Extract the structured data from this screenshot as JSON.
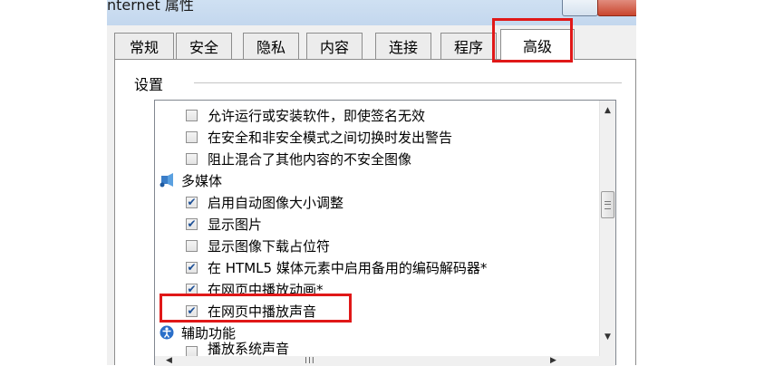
{
  "window": {
    "title": "nternet 属性"
  },
  "tabs": [
    {
      "label": "常规",
      "active": false
    },
    {
      "label": "安全",
      "active": false
    },
    {
      "label": "隐私",
      "active": false
    },
    {
      "label": "内容",
      "active": false
    },
    {
      "label": "连接",
      "active": false
    },
    {
      "label": "程序",
      "active": false
    },
    {
      "label": "高级",
      "active": true
    }
  ],
  "settings": {
    "label": "设置",
    "items": [
      {
        "type": "option",
        "label": "允许运行或安装软件，即使签名无效",
        "checked": false
      },
      {
        "type": "option",
        "label": "在安全和非安全模式之间切换时发出警告",
        "checked": false
      },
      {
        "type": "option",
        "label": "阻止混合了其他内容的不安全图像",
        "checked": false
      },
      {
        "type": "category",
        "label": "多媒体",
        "icon": "multimedia-icon"
      },
      {
        "type": "option",
        "label": "启用自动图像大小调整",
        "checked": true
      },
      {
        "type": "option",
        "label": "显示图片",
        "checked": true
      },
      {
        "type": "option",
        "label": "显示图像下载占位符",
        "checked": false
      },
      {
        "type": "option",
        "label": "在 HTML5 媒体元素中启用备用的编码解码器*",
        "checked": true
      },
      {
        "type": "option",
        "label": "在网页中播放动画*",
        "checked": true
      },
      {
        "type": "option",
        "label": "在网页中播放声音",
        "checked": true
      },
      {
        "type": "category",
        "label": "辅助功能",
        "icon": "accessibility-icon"
      },
      {
        "type": "option",
        "label": "播放系统声音",
        "checked": false
      }
    ]
  },
  "colors": {
    "highlight": "#e01818",
    "check": "#1c4f96"
  }
}
